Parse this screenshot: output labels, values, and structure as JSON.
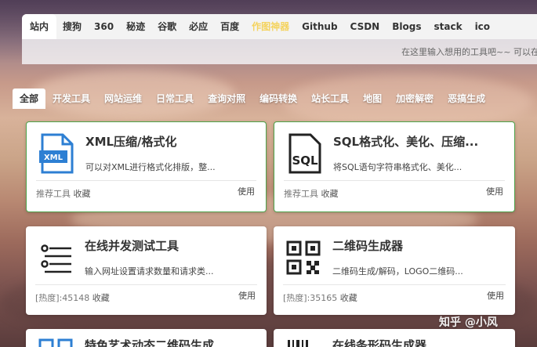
{
  "tabs": [
    {
      "label": "站内",
      "active": true
    },
    {
      "label": "搜狗"
    },
    {
      "label": "360"
    },
    {
      "label": "秘迹"
    },
    {
      "label": "谷歌"
    },
    {
      "label": "必应"
    },
    {
      "label": "百度"
    },
    {
      "label": "作图神器",
      "highlight": true
    },
    {
      "label": "Github"
    },
    {
      "label": "CSDN"
    },
    {
      "label": "Blogs"
    },
    {
      "label": "stack"
    },
    {
      "label": "ico"
    }
  ],
  "search": {
    "placeholder": "在这里输入想用的工具吧~~ 可以在"
  },
  "categories": [
    {
      "label": "全部",
      "active": true
    },
    {
      "label": "开发工具"
    },
    {
      "label": "网站运维"
    },
    {
      "label": "日常工具"
    },
    {
      "label": "查询对照"
    },
    {
      "label": "编码转换"
    },
    {
      "label": "站长工具"
    },
    {
      "label": "地图"
    },
    {
      "label": "加密解密"
    },
    {
      "label": "恶搞生成"
    }
  ],
  "cards": [
    {
      "title": "XML压缩/格式化",
      "desc": "可以对XML进行格式化排版，整...",
      "meta_tag": "推荐工具",
      "meta_extra": "收藏",
      "use": "使用",
      "icon": "xml-file-icon"
    },
    {
      "title": "SQL格式化、美化、压缩...",
      "desc": "将SQL语句字符串格式化、美化...",
      "meta_tag": "推荐工具",
      "meta_extra": "收藏",
      "use": "使用",
      "icon": "sql-icon"
    },
    {
      "title": "在线并发测试工具",
      "desc": "输入网址设置请求数量和请求类...",
      "meta_tag": "[热度]:45148",
      "meta_extra": "收藏",
      "use": "使用",
      "icon": "list-icon"
    },
    {
      "title": "二维码生成器",
      "desc": "二维码生成/解码，LOGO二维码...",
      "meta_tag": "[热度]:35165",
      "meta_extra": "收藏",
      "use": "使用",
      "icon": "qrcode-icon"
    },
    {
      "title": "特色艺术动态二维码生成",
      "icon": "qrcode-icon"
    },
    {
      "title": "在线条形码生成器",
      "icon": "barcode-icon"
    }
  ],
  "watermark": "知乎 @小风",
  "colors": {
    "accent_border": "#4fa34b",
    "highlight_tab": "#f4d35e",
    "icon_blue": "#2d7fd3"
  }
}
